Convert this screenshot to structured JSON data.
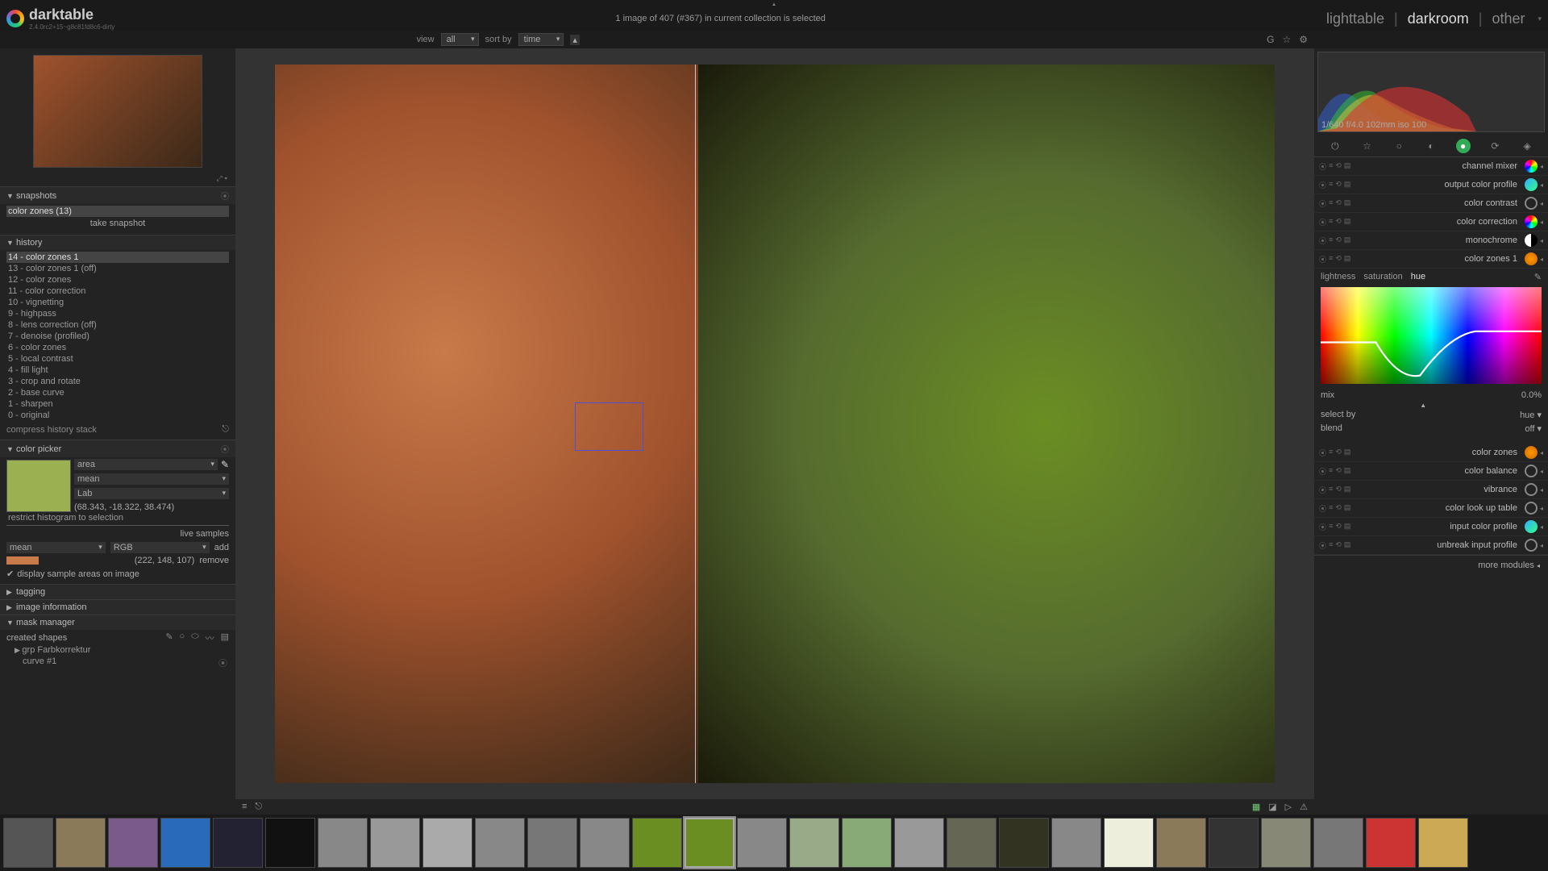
{
  "app": {
    "name": "darktable",
    "version": "2.4.0rc2+15~g8c81fd8c6-dirty"
  },
  "header": {
    "status": "1 image of 407 (#367) in current collection is selected",
    "views": {
      "lighttable": "lighttable",
      "darkroom": "darkroom",
      "other": "other"
    }
  },
  "toolbar": {
    "view_label": "view",
    "view_value": "all",
    "sort_label": "sort by",
    "sort_value": "time"
  },
  "left": {
    "snapshots": {
      "title": "snapshots",
      "item": "color zones (13)",
      "take": "take snapshot"
    },
    "history": {
      "title": "history",
      "items": [
        "14 - color zones 1",
        "13 - color zones 1 (off)",
        "12 - color zones",
        "11 - color correction",
        "10 - vignetting",
        "9 - highpass",
        "8 - lens correction (off)",
        "7 - denoise (profiled)",
        "6 - color zones",
        "5 - local contrast",
        "4 - fill light",
        "3 - crop and rotate",
        "2 - base curve",
        "1 - sharpen",
        "0 - original"
      ],
      "compress": "compress history stack"
    },
    "colorpicker": {
      "title": "color picker",
      "mode": "area",
      "stat": "mean",
      "space": "Lab",
      "lab_values": "(68.343, -18.322, 38.474)",
      "restrict": "restrict histogram to selection",
      "live_samples": "live samples",
      "sample_stat": "mean",
      "sample_space": "RGB",
      "add": "add",
      "sample_values": "(222, 148, 107)",
      "remove": "remove",
      "display_check": "display sample areas on image"
    },
    "tagging": {
      "title": "tagging"
    },
    "imageinfo": {
      "title": "image information"
    },
    "maskmgr": {
      "title": "mask manager",
      "created": "created shapes",
      "grp": "grp Farbkorrektur",
      "curve": "curve #1"
    }
  },
  "right": {
    "histo_info": "1/640 f/4.0 102mm iso 100",
    "modules": [
      {
        "name": "channel mixer",
        "icon": "rainbow"
      },
      {
        "name": "output color profile",
        "icon": "bluegreen"
      },
      {
        "name": "color contrast",
        "icon": "ring"
      },
      {
        "name": "color correction",
        "icon": "rainbow"
      },
      {
        "name": "monochrome",
        "icon": "half"
      },
      {
        "name": "color zones 1",
        "icon": "orange",
        "expanded": true
      },
      {
        "name": "color zones",
        "icon": "orange"
      },
      {
        "name": "color balance",
        "icon": "ring"
      },
      {
        "name": "vibrance",
        "icon": "ring"
      },
      {
        "name": "color look up table",
        "icon": "ring"
      },
      {
        "name": "input color profile",
        "icon": "bluegreen"
      },
      {
        "name": "unbreak input profile",
        "icon": "ring"
      }
    ],
    "czones": {
      "tabs": {
        "lightness": "lightness",
        "saturation": "saturation",
        "hue": "hue"
      },
      "mix_label": "mix",
      "mix_value": "0.0%",
      "selectby_label": "select by",
      "selectby_value": "hue",
      "blend_label": "blend",
      "blend_value": "off"
    },
    "more": "more modules"
  },
  "thumb_colors": [
    "#555",
    "#8a7a5a",
    "#7a5a8a",
    "#2a6aba",
    "#223",
    "#111",
    "#888",
    "#999",
    "#aaa",
    "#888",
    "#777",
    "#888",
    "#6b8e23",
    "#6b8e23",
    "#888",
    "#9a8",
    "#8a7",
    "#999",
    "#665",
    "#332",
    "#888",
    "#eed",
    "#8a7a5a",
    "#333",
    "#887",
    "#777",
    "#c33",
    "#ca5"
  ]
}
